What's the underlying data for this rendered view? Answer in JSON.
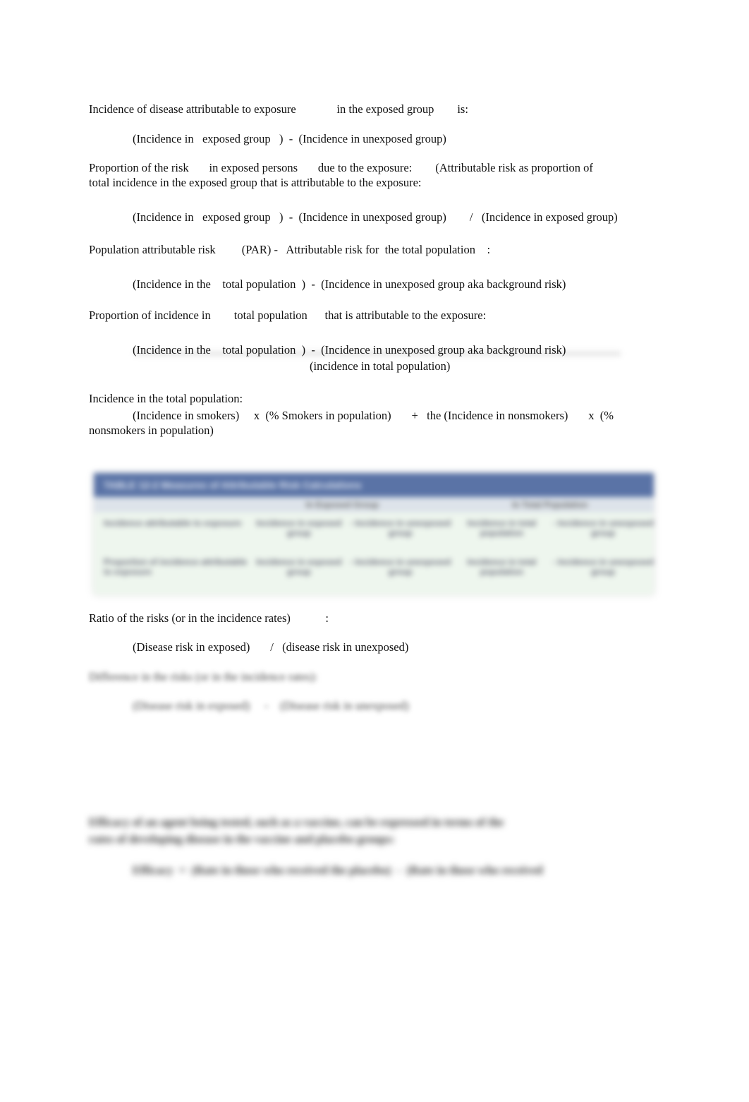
{
  "lines": {
    "l1": "Incidence of disease attributable to exposure              in the exposed group        is:",
    "l2": "(Incidence in   exposed group   )  -  (Incidence in unexposed group)",
    "l3a": "Proportion of the risk       in exposed persons       due to the exposure:        (Attributable risk as proportion of",
    "l3b": "total incidence in the exposed group that is attributable to the exposure:",
    "l4": "(Incidence in   exposed group   )  -  (Incidence in unexposed group)        /   (Incidence in exposed group)",
    "l5": "Population attributable risk         (PAR) -   Attributable risk for  the total population    :",
    "l6": "(Incidence in the    total population  )  -  (Incidence in unexposed group aka background risk)",
    "l7": "Proportion of incidence in        total population      that is attributable to the exposure:",
    "l8": "(Incidence in the    total population  )  -  (Incidence in unexposed group aka background risk)",
    "l8b": "(incidence in total population)",
    "l9": "Incidence in the total population:",
    "l10": "(Incidence in smokers)     x  (% Smokers in population)       +   the (Incidence in nonsmokers)       x  (%",
    "l10b": "nonsmokers in population)",
    "l11": "Ratio of the risks (or in the incidence rates)            :",
    "l12": "(Disease risk in exposed)       /   (disease risk in unexposed)",
    "l13": "Difference in the risks (or in the incidence rates):",
    "l14": "(Disease risk in exposed)     -    (Disease risk in unexposed)",
    "l15a": "Efficacy of an agent being tested, such as a vaccine, can be expressed in terms of the",
    "l15b": "rates of developing disease in the vaccine and placebo groups:",
    "l16": "Efficacy  =  (Rate in those who received the placebo)  -  (Rate in those who received"
  },
  "table": {
    "title": "TABLE 12-2   Measures of Attributable Risk Calculations",
    "headers": [
      "",
      "In Exposed Group",
      "In Total Population"
    ],
    "rows": [
      [
        "Incidence attributable to exposure",
        "Incidence in exposed group",
        "- Incidence in unexposed group",
        "Incidence in total population",
        "- Incidence in unexposed group"
      ],
      [
        "Proportion of incidence attributable to exposure",
        "Incidence in exposed group",
        "- Incidence in unexposed group",
        "Incidence in total population",
        "- Incidence in unexposed group"
      ]
    ]
  }
}
